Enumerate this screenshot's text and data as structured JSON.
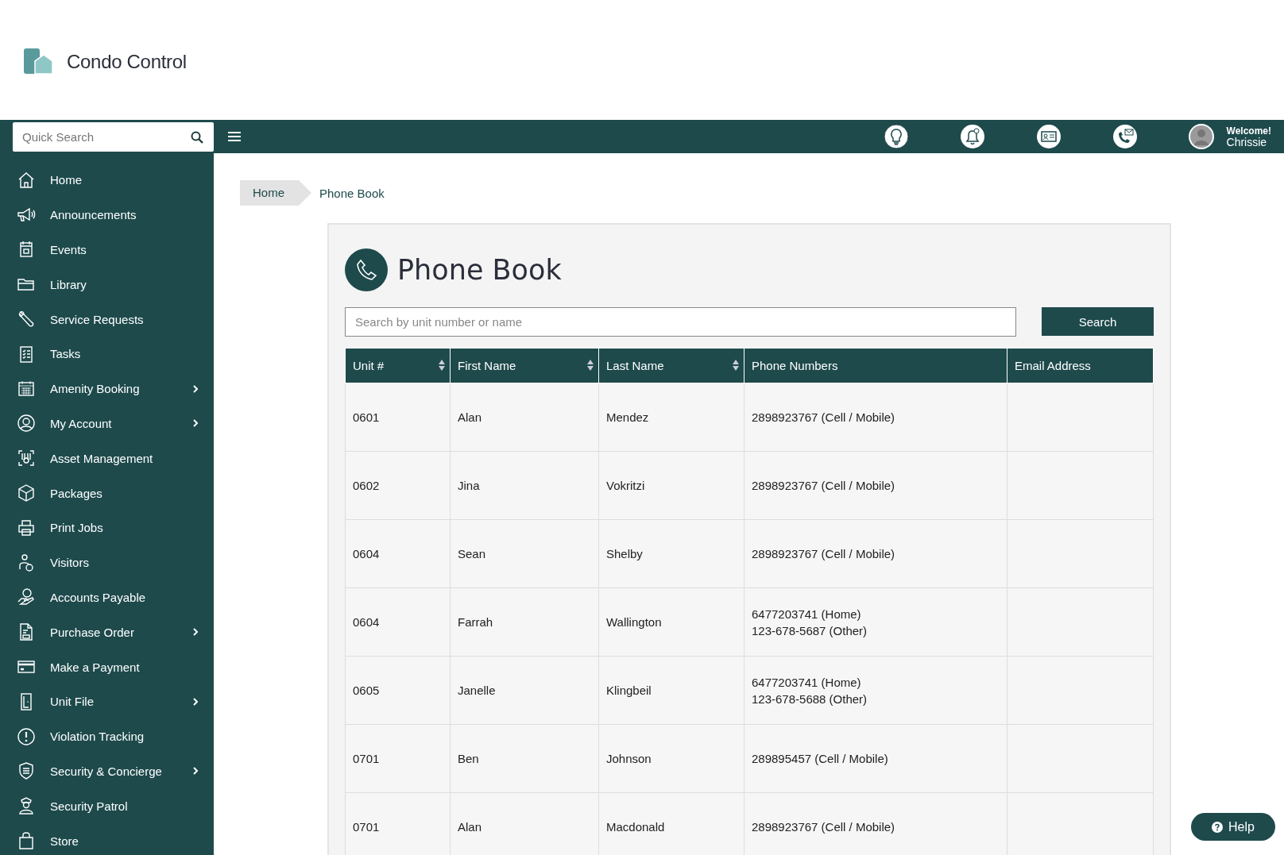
{
  "brand": {
    "name": "Condo Control"
  },
  "topbar": {
    "quick_search": {
      "placeholder": "Quick Search"
    },
    "welcome": "Welcome!",
    "user": "Chrissie"
  },
  "sidebar": {
    "items": [
      {
        "label": "Home",
        "has_submenu": false
      },
      {
        "label": "Announcements",
        "has_submenu": false
      },
      {
        "label": "Events",
        "has_submenu": false
      },
      {
        "label": "Library",
        "has_submenu": false
      },
      {
        "label": "Service Requests",
        "has_submenu": false
      },
      {
        "label": "Tasks",
        "has_submenu": false
      },
      {
        "label": "Amenity Booking",
        "has_submenu": true
      },
      {
        "label": "My Account",
        "has_submenu": true
      },
      {
        "label": "Asset Management",
        "has_submenu": false
      },
      {
        "label": "Packages",
        "has_submenu": false
      },
      {
        "label": "Print Jobs",
        "has_submenu": false
      },
      {
        "label": "Visitors",
        "has_submenu": false
      },
      {
        "label": "Accounts Payable",
        "has_submenu": false
      },
      {
        "label": "Purchase Order",
        "has_submenu": true
      },
      {
        "label": "Make a Payment",
        "has_submenu": false
      },
      {
        "label": "Unit File",
        "has_submenu": true
      },
      {
        "label": "Violation Tracking",
        "has_submenu": false
      },
      {
        "label": "Security & Concierge",
        "has_submenu": true
      },
      {
        "label": "Security Patrol",
        "has_submenu": false
      },
      {
        "label": "Store",
        "has_submenu": false
      }
    ]
  },
  "breadcrumb": [
    "Home",
    "Phone Book"
  ],
  "page": {
    "title": "Phone Book",
    "search": {
      "placeholder": "Search by unit number or name"
    },
    "search_button": "Search"
  },
  "table": {
    "columns": [
      {
        "label": "Unit #",
        "sortable": true
      },
      {
        "label": "First Name",
        "sortable": true
      },
      {
        "label": "Last Name",
        "sortable": true
      },
      {
        "label": "Phone Numbers",
        "sortable": false
      },
      {
        "label": "Email Address",
        "sortable": false
      }
    ],
    "rows": [
      {
        "unit": "0601",
        "first": "Alan",
        "last": "Mendez",
        "phones": [
          "2898923767 (Cell / Mobile)"
        ]
      },
      {
        "unit": "0602",
        "first": "Jina",
        "last": "Vokritzi",
        "phones": [
          "2898923767 (Cell / Mobile)"
        ]
      },
      {
        "unit": "0604",
        "first": "Sean",
        "last": "Shelby",
        "phones": [
          "2898923767 (Cell / Mobile)"
        ]
      },
      {
        "unit": "0604",
        "first": "Farrah",
        "last": "Wallington",
        "phones": [
          "6477203741 (Home)",
          "123-678-5687 (Other)"
        ]
      },
      {
        "unit": "0605",
        "first": "Janelle",
        "last": "Klingbeil",
        "phones": [
          "6477203741 (Home)",
          "123-678-5688 (Other)"
        ]
      },
      {
        "unit": "0701",
        "first": "Ben",
        "last": "Johnson",
        "phones": [
          "289895457 (Cell / Mobile)"
        ]
      },
      {
        "unit": "0701",
        "first": "Alan",
        "last": "Macdonald",
        "phones": [
          "2898923767 (Cell / Mobile)"
        ]
      }
    ]
  },
  "help_button": "Help"
}
